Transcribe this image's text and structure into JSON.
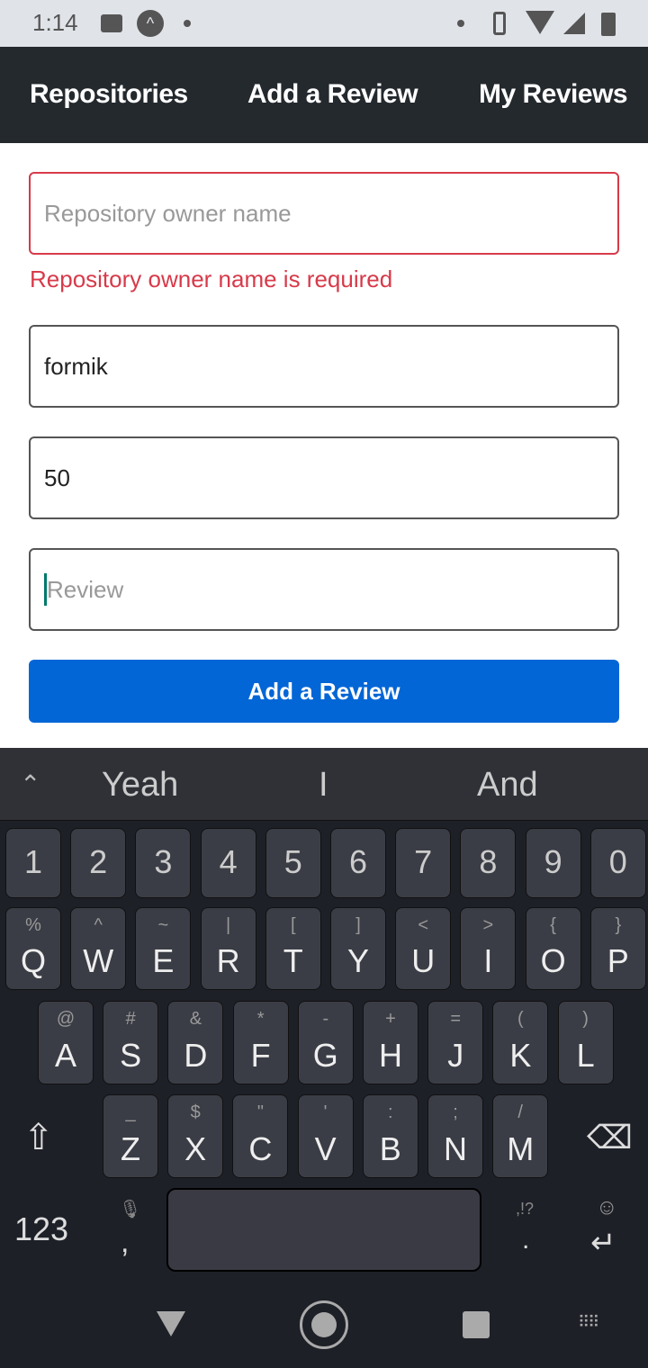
{
  "status": {
    "time": "1:14"
  },
  "nav": {
    "tabs": [
      "Repositories",
      "Add a Review",
      "My Reviews"
    ]
  },
  "form": {
    "owner": {
      "placeholder": "Repository owner name",
      "value": "",
      "error": "Repository owner name is required"
    },
    "repo": {
      "value": "formik"
    },
    "rating": {
      "value": "50"
    },
    "review": {
      "placeholder": "Review",
      "value": ""
    },
    "submit": "Add a Review"
  },
  "colors": {
    "error": "#d73a4a",
    "primary": "#0366d6",
    "nav": "#24292e"
  },
  "keyboard": {
    "suggestions": [
      "Yeah",
      "I",
      "And"
    ],
    "numbers": [
      "1",
      "2",
      "3",
      "4",
      "5",
      "6",
      "7",
      "8",
      "9",
      "0"
    ],
    "row1": [
      [
        "Q",
        "%"
      ],
      [
        "W",
        "^"
      ],
      [
        "E",
        "~"
      ],
      [
        "R",
        "|"
      ],
      [
        "T",
        "["
      ],
      [
        "Y",
        "]"
      ],
      [
        "U",
        "<"
      ],
      [
        "I",
        ">"
      ],
      [
        "O",
        "{"
      ],
      [
        "P",
        "}"
      ]
    ],
    "row2": [
      [
        "A",
        "@"
      ],
      [
        "S",
        "#"
      ],
      [
        "D",
        "&"
      ],
      [
        "F",
        "*"
      ],
      [
        "G",
        "-"
      ],
      [
        "H",
        "+"
      ],
      [
        "J",
        "="
      ],
      [
        "K",
        "("
      ],
      [
        "L",
        ")"
      ]
    ],
    "row3": [
      [
        "Z",
        "_"
      ],
      [
        "X",
        "$"
      ],
      [
        "C",
        "\""
      ],
      [
        "V",
        "'"
      ],
      [
        "B",
        ":"
      ],
      [
        "N",
        ";"
      ],
      [
        "M",
        "/"
      ]
    ],
    "symbols_key": "123",
    "comma": ",",
    "period": ".",
    "punct_hint": ",!?"
  }
}
